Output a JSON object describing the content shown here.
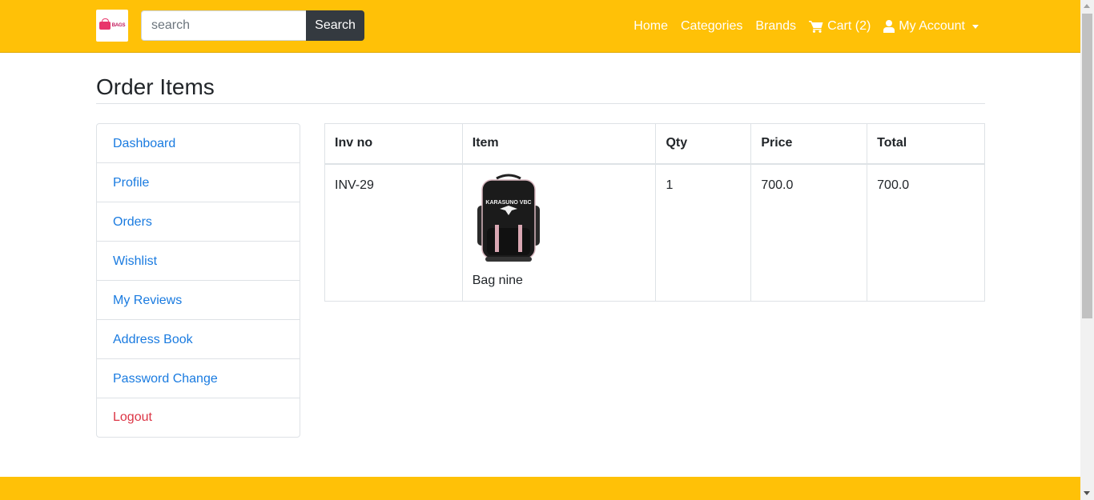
{
  "navbar": {
    "logo_text": "BAGS",
    "search_placeholder": "search",
    "search_button": "Search",
    "links": {
      "home": "Home",
      "categories": "Categories",
      "brands": "Brands",
      "cart": "Cart (2)",
      "account": "My Account"
    },
    "accent_color": "#ffc107"
  },
  "page": {
    "title": "Order Items"
  },
  "sidebar": {
    "items": [
      {
        "label": "Dashboard"
      },
      {
        "label": "Profile"
      },
      {
        "label": "Orders"
      },
      {
        "label": "Wishlist"
      },
      {
        "label": "My Reviews"
      },
      {
        "label": "Address Book"
      },
      {
        "label": "Password Change"
      },
      {
        "label": "Logout"
      }
    ],
    "link_color": "#1a7be0",
    "logout_color": "#dc3545"
  },
  "table": {
    "headers": {
      "inv": "Inv no",
      "item": "Item",
      "qty": "Qty",
      "price": "Price",
      "total": "Total"
    },
    "rows": [
      {
        "inv": "INV-29",
        "item_name": "Bag nine",
        "item_image_print": "KARASUNO VBC",
        "qty": "1",
        "price": "700.0",
        "total": "700.0"
      }
    ]
  }
}
